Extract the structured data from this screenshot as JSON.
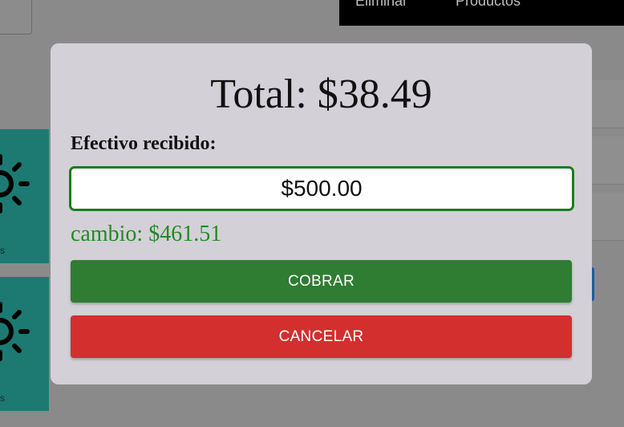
{
  "background": {
    "tabs": [
      "Eliminar",
      "Productos"
    ],
    "card_captions": [
      "s",
      "s"
    ],
    "card_icon": "sun-icon"
  },
  "modal": {
    "total_text": "Total: $38.49",
    "cash_label": "Efectivo recibido:",
    "cash_value": "$500.00",
    "change_text": "cambio: $461.51",
    "charge_button": "COBRAR",
    "cancel_button": "CANCELAR"
  },
  "colors": {
    "charge": "#2e7d32",
    "cancel": "#d32f2f",
    "change_text": "#228b22",
    "input_border": "#1c7d1c",
    "modal_bg": "#d3d0d7"
  }
}
